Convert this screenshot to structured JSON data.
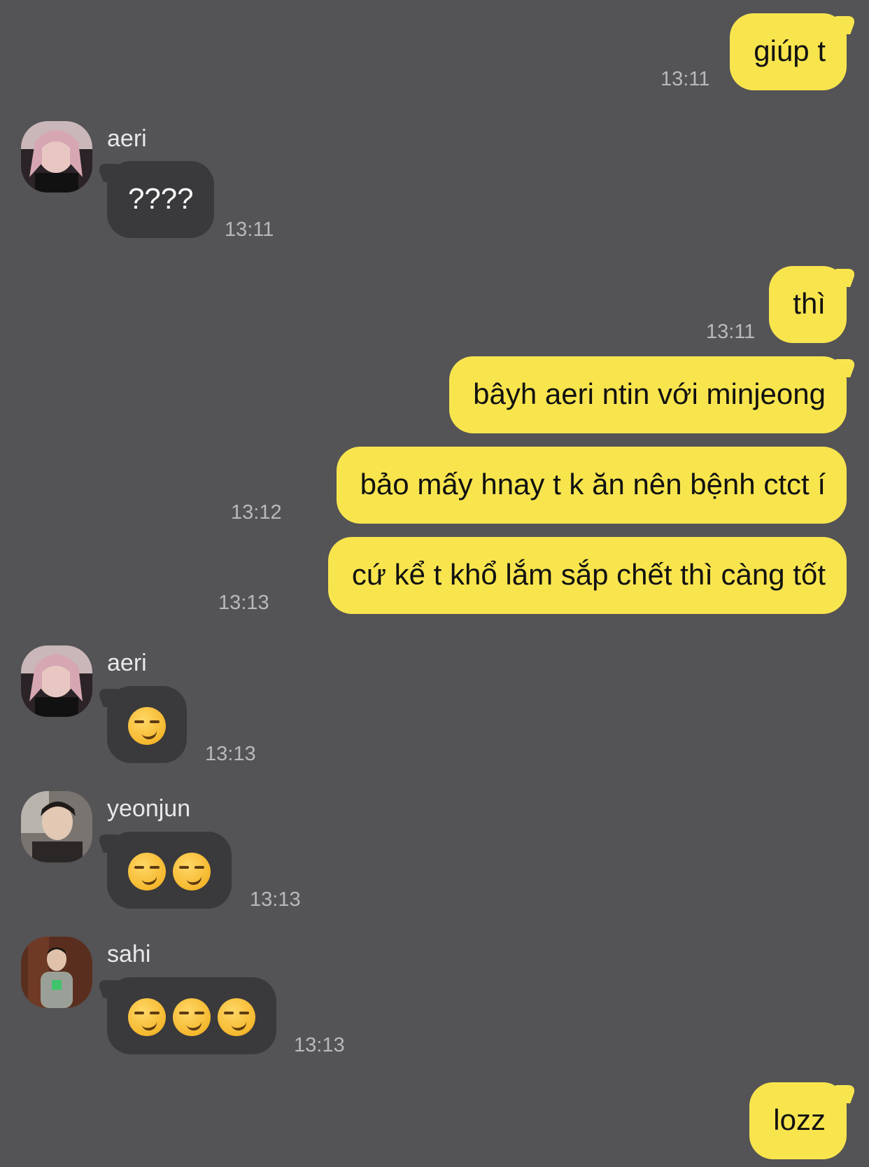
{
  "messages": {
    "m1": {
      "text": "giúp t",
      "time": "13:11"
    },
    "m2": {
      "sender": "aeri",
      "text": "????",
      "time": "13:11"
    },
    "m3": {
      "text": "thì",
      "time": "13:11"
    },
    "m4": {
      "text": "bâyh aeri ntin với minjeong"
    },
    "m5": {
      "text": "bảo mấy hnay t k ăn nên bệnh ctct í",
      "time": "13:12"
    },
    "m6": {
      "text": "cứ kể t khổ lắm sắp chết thì càng tốt",
      "time": "13:13"
    },
    "m7": {
      "sender": "aeri",
      "emoji_count": 1,
      "emoji": "smirking-face-icon",
      "time": "13:13"
    },
    "m8": {
      "sender": "yeonjun",
      "emoji_count": 2,
      "emoji": "smirking-face-icon",
      "time": "13:13"
    },
    "m9": {
      "sender": "sahi",
      "emoji_count": 3,
      "emoji": "smirking-face-icon",
      "time": "13:13"
    },
    "m10": {
      "text": "lozz"
    }
  },
  "colors": {
    "background": "#545356",
    "outgoing_bubble": "#f8e54e",
    "incoming_bubble": "#3a3a3c"
  }
}
